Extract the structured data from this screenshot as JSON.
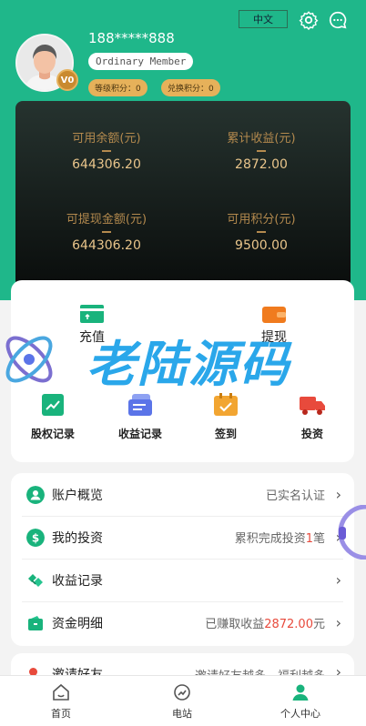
{
  "header": {
    "language_button": "中文",
    "phone": "188*****888",
    "member_level": "Ordinary Member",
    "vip_badge": "V0",
    "grade_points": "等级积分：0",
    "exchange_points": "兑换积分：0"
  },
  "balance": [
    {
      "label": "可用余额(元)",
      "value": "644306.20"
    },
    {
      "label": "累计收益(元)",
      "value": "2872.00"
    },
    {
      "label": "可提现金额(元)",
      "value": "644306.20"
    },
    {
      "label": "可用积分(元)",
      "value": "9500.00"
    }
  ],
  "actions": {
    "recharge": "充值",
    "withdraw": "提现"
  },
  "watermark": "老陆源码",
  "functions": [
    {
      "label": "股权记录",
      "icon": "equity-chart-icon",
      "color": "#19b37c"
    },
    {
      "label": "收益记录",
      "icon": "income-record-icon",
      "color": "#5b74e8"
    },
    {
      "label": "签到",
      "icon": "checkin-calendar-icon",
      "color": "#f2a531"
    },
    {
      "label": "投资",
      "icon": "truck-icon",
      "color": "#e84a3c"
    }
  ],
  "menu": [
    {
      "label": "账户概览",
      "value": "已实名认证",
      "icon": "user-circle-icon"
    },
    {
      "label": "我的投资",
      "value_prefix": "累积完成投资",
      "value_highlight": "1",
      "value_suffix": "笔",
      "icon": "dollar-circle-icon"
    },
    {
      "label": "收益记录",
      "value": "",
      "icon": "handshake-icon"
    },
    {
      "label": "资金明细",
      "value_prefix": "已赚取收益",
      "value_highlight": "2872.00",
      "value_suffix": "元",
      "icon": "wallet-icon"
    }
  ],
  "invite": {
    "label": "邀请好友",
    "value": "邀请好友越多，福利越多"
  },
  "tabbar": [
    {
      "label": "首页",
      "icon": "home-icon"
    },
    {
      "label": "电站",
      "icon": "power-station-icon"
    },
    {
      "label": "个人中心",
      "icon": "profile-icon"
    }
  ],
  "colors": {
    "brand_green": "#1fb78a",
    "gold": "#e9c58b",
    "highlight_red": "#e84a3c"
  }
}
